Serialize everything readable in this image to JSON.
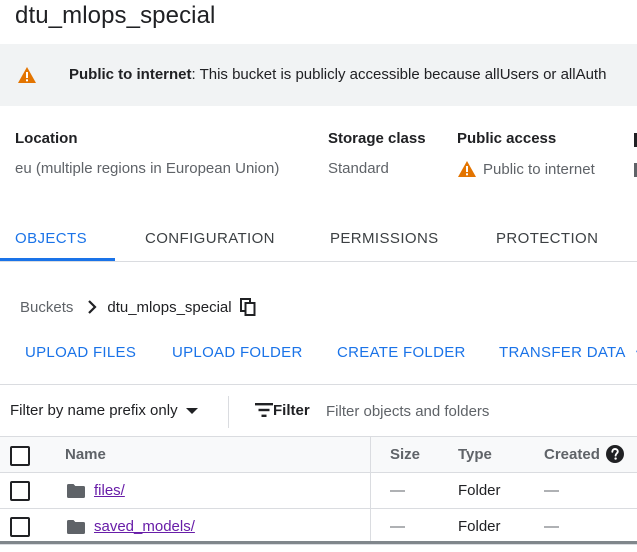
{
  "bucket": {
    "title": "dtu_mlops_special"
  },
  "banner": {
    "icon": "warning-icon",
    "strong": "Public to internet",
    "text": ": This bucket is publicly accessible because allUsers or allAuth"
  },
  "meta": {
    "location": {
      "label": "Location",
      "value": "eu (multiple regions in European Union)"
    },
    "storage_class": {
      "label": "Storage class",
      "value": "Standard"
    },
    "public_access": {
      "label": "Public access",
      "value": "Public to internet"
    }
  },
  "tabs": [
    {
      "label": "OBJECTS",
      "active": true
    },
    {
      "label": "CONFIGURATION",
      "active": false
    },
    {
      "label": "PERMISSIONS",
      "active": false
    },
    {
      "label": "PROTECTION",
      "active": false
    }
  ],
  "breadcrumb": {
    "root": "Buckets",
    "current": "dtu_mlops_special"
  },
  "actions": {
    "upload_files": "UPLOAD FILES",
    "upload_folder": "UPLOAD FOLDER",
    "create_folder": "CREATE FOLDER",
    "transfer_data": "TRANSFER DATA"
  },
  "filter": {
    "prefix_select": "Filter by name prefix only",
    "filter_label": "Filter",
    "placeholder": "Filter objects and folders"
  },
  "table": {
    "headers": {
      "name": "Name",
      "size": "Size",
      "type": "Type",
      "created": "Created"
    },
    "rows": [
      {
        "name": "files/",
        "size": "—",
        "type": "Folder",
        "created": "—"
      },
      {
        "name": "saved_models/",
        "size": "—",
        "type": "Folder",
        "created": "—"
      }
    ]
  },
  "colors": {
    "accent": "#1a73e8",
    "warning": "#e37400",
    "link_visited": "#681da8"
  }
}
